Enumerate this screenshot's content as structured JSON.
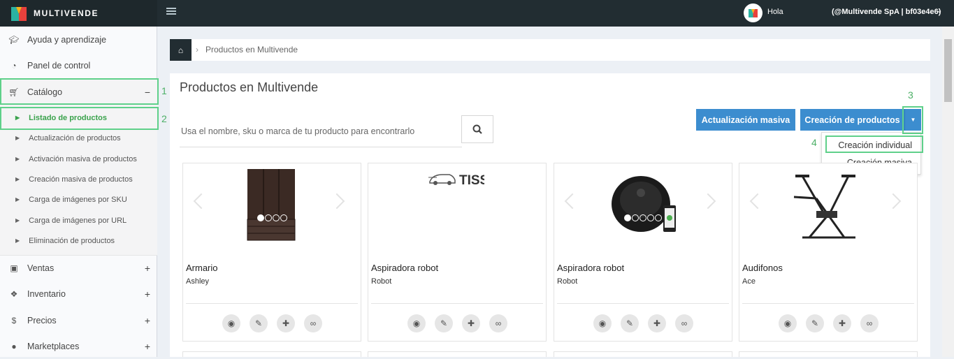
{
  "header": {
    "logo_text": "MULTIVENDE",
    "greeting": "Hola",
    "account": "(@Multivende SpA | bf03e4e6)"
  },
  "sidebar": {
    "items": [
      {
        "label": "Ayuda y aprendizaje",
        "icon": "graduation-cap-icon"
      },
      {
        "label": "Panel de control",
        "icon": "dashboard-icon"
      },
      {
        "label": "Catálogo",
        "icon": "cart-icon",
        "toggle": "−"
      },
      {
        "label": "Ventas",
        "icon": "money-icon",
        "toggle": "+"
      },
      {
        "label": "Inventario",
        "icon": "cubes-icon",
        "toggle": "+"
      },
      {
        "label": "Precios",
        "icon": "dollar-icon",
        "toggle": "+"
      },
      {
        "label": "Marketplaces",
        "icon": "globe-icon",
        "toggle": "+"
      }
    ],
    "submenu": [
      "Listado de productos",
      "Actualización de productos",
      "Activación masiva de productos",
      "Creación masiva de productos",
      "Carga de imágenes por SKU",
      "Carga de imágenes por URL",
      "Eliminación de productos"
    ]
  },
  "annotations": [
    "1",
    "2",
    "3",
    "4"
  ],
  "breadcrumb": {
    "current": "Productos en Multivende"
  },
  "main": {
    "title": "Productos en Multivende",
    "search_placeholder": "Usa el nombre, sku o marca de tu producto para encontrarlo",
    "btn_update": "Actualización masiva",
    "btn_create": "Creación de productos",
    "dropdown": [
      "Creación individual",
      "Creación masiva"
    ]
  },
  "products": [
    {
      "name": "Armario",
      "brand": "Ashley"
    },
    {
      "name": "Aspiradora robot",
      "brand": "Robot"
    },
    {
      "name": "Aspiradora robot",
      "brand": "Robot"
    },
    {
      "name": "Audifonos",
      "brand": "Ace"
    }
  ],
  "colors": {
    "accent": "#3c8dcf",
    "highlight": "#5fd08a",
    "topbar": "#222d32"
  }
}
